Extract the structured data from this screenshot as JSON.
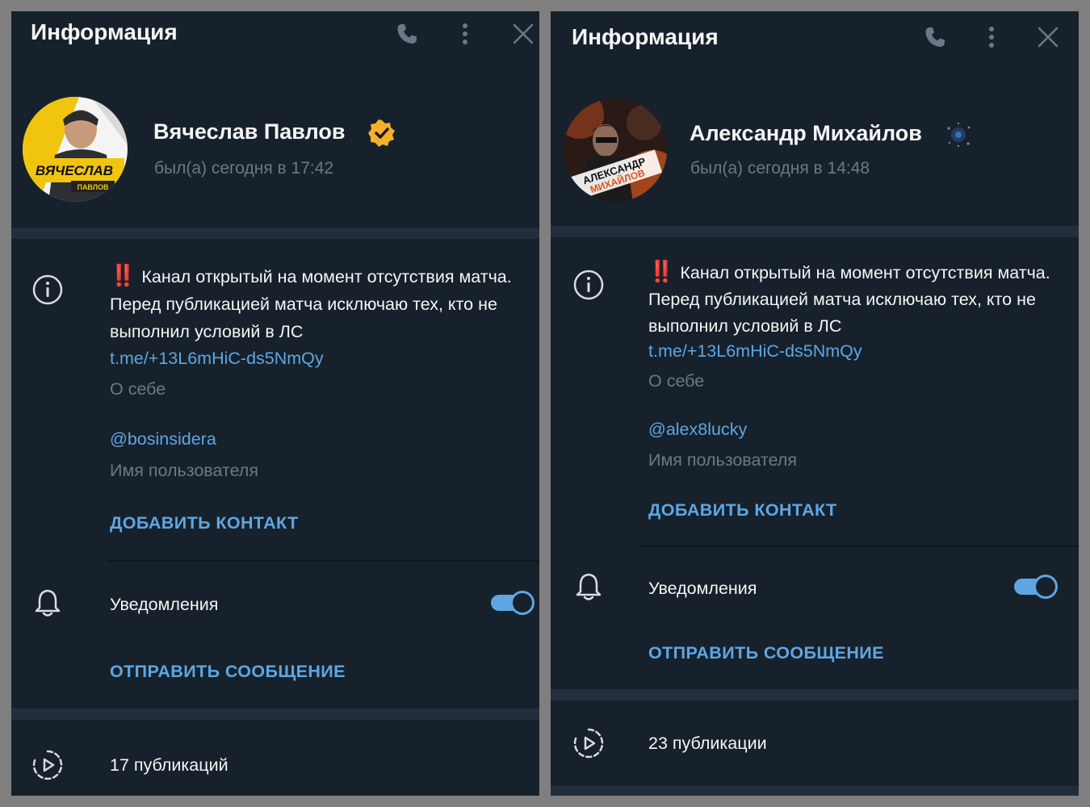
{
  "panels": [
    {
      "header": {
        "title": "Информация"
      },
      "profile": {
        "name": "Вячеслав Павлов",
        "status": "был(а) сегодня в 17:42",
        "avatar_text_1": "ВЯЧЕСЛАВ",
        "avatar_text_2": "ПАВЛОВ",
        "badge_icon": "verified-badge-icon",
        "badge_color": "#f2b128"
      },
      "bio": {
        "emoji": "‼️",
        "text": "Канал открытый на момент отсутствия матча. Перед публикацией матча исключаю тех, кто не выполнил условий в ЛС",
        "link": "t.me/+13L6mHiC-ds5NmQy",
        "label": "О себе"
      },
      "username": {
        "value": "@bosinsidera",
        "label": "Имя пользователя"
      },
      "add_contact": "ДОБАВИТЬ КОНТАКТ",
      "notifications": {
        "label": "Уведомления",
        "enabled": true
      },
      "send_message": "ОТПРАВИТЬ СООБЩЕНИЕ",
      "publications": "17 публикаций"
    },
    {
      "header": {
        "title": "Информация"
      },
      "profile": {
        "name": "Александр Михайлов",
        "status": "был(а) сегодня в 14:48",
        "avatar_text_1": "АЛЕКСАНДР",
        "avatar_text_2": "МИХАЙЛОВ",
        "badge_icon": "sparkle-status-icon",
        "badge_color": "#3a6fb0"
      },
      "bio": {
        "emoji": "‼️",
        "text": "Канал открытый на момент отсутствия матча. Перед публикацией матча исключаю тех, кто не выполнил условий в ЛС",
        "link": "t.me/+13L6mHiC-ds5NmQy",
        "label": "О себе"
      },
      "username": {
        "value": "@alex8lucky",
        "label": "Имя пользователя"
      },
      "add_contact": "ДОБАВИТЬ КОНТАКТ",
      "notifications": {
        "label": "Уведомления",
        "enabled": true
      },
      "send_message": "ОТПРАВИТЬ СООБЩЕНИЕ",
      "publications": "23 публикации"
    }
  ],
  "colors": {
    "panel_bg": "#17212b",
    "divider": "#232e3c",
    "accent": "#5ea6e3",
    "secondary_text": "#6d7883",
    "primary_text": "#f5f5f5"
  }
}
